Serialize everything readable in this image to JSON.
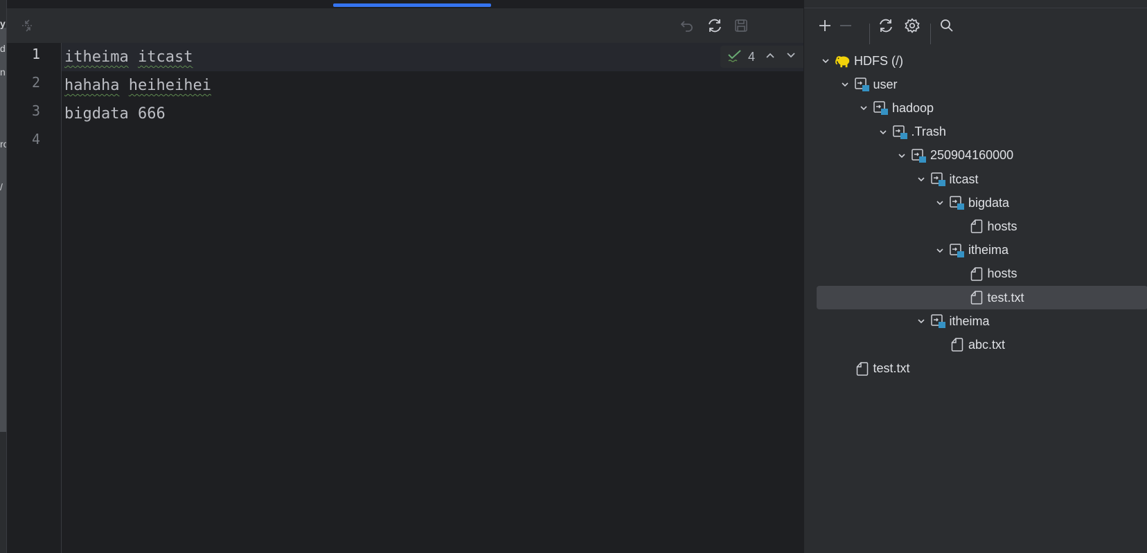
{
  "left_panel": {
    "fragments": [
      "y",
      "d",
      "n",
      "rc",
      "/"
    ]
  },
  "editor": {
    "lines": [
      {
        "num": "1",
        "words": [
          {
            "text": "itheima",
            "typo": true
          },
          {
            "text": " ",
            "typo": false
          },
          {
            "text": "itcast",
            "typo": true
          }
        ]
      },
      {
        "num": "2",
        "words": [
          {
            "text": "hahaha",
            "typo": true
          },
          {
            "text": " ",
            "typo": false
          },
          {
            "text": "heiheihei",
            "typo": true
          }
        ]
      },
      {
        "num": "3",
        "words": [
          {
            "text": "bigdata 666",
            "typo": false
          }
        ]
      },
      {
        "num": "4",
        "words": []
      }
    ],
    "inspection_count": "4",
    "icons": {
      "collapse": "collapse-icon",
      "undo": "undo-icon",
      "reload": "reload-icon",
      "save": "save-icon"
    }
  },
  "hdfs_panel": {
    "toolbar": [
      "add-icon",
      "remove-icon",
      "refresh-icon",
      "settings-icon",
      "search-icon"
    ],
    "tree": [
      {
        "label": "HDFS (/)",
        "depth": 0,
        "type": "root",
        "expanded": true
      },
      {
        "label": "user",
        "depth": 1,
        "type": "folder",
        "expanded": true
      },
      {
        "label": "hadoop",
        "depth": 2,
        "type": "folder",
        "expanded": true
      },
      {
        "label": ".Trash",
        "depth": 3,
        "type": "folder",
        "expanded": true
      },
      {
        "label": "250904160000",
        "depth": 4,
        "type": "folder",
        "expanded": true
      },
      {
        "label": "itcast",
        "depth": 5,
        "type": "folder",
        "expanded": true
      },
      {
        "label": "bigdata",
        "depth": 6,
        "type": "folder",
        "expanded": true
      },
      {
        "label": "hosts",
        "depth": 7,
        "type": "file"
      },
      {
        "label": "itheima",
        "depth": 6,
        "type": "folder",
        "expanded": true
      },
      {
        "label": "hosts",
        "depth": 7,
        "type": "file"
      },
      {
        "label": "test.txt",
        "depth": 7,
        "type": "file",
        "selected": true
      },
      {
        "label": "itheima",
        "depth": 5,
        "type": "folder",
        "expanded": true
      },
      {
        "label": "abc.txt",
        "depth": 6,
        "type": "file"
      },
      {
        "label": "test.txt",
        "depth": 1,
        "type": "file"
      }
    ]
  },
  "colors": {
    "accent": "#3574f0",
    "folder_badge": "#3592c4",
    "hadoop_yellow": "#f2d20a",
    "inspection_green": "#5f8c50"
  }
}
